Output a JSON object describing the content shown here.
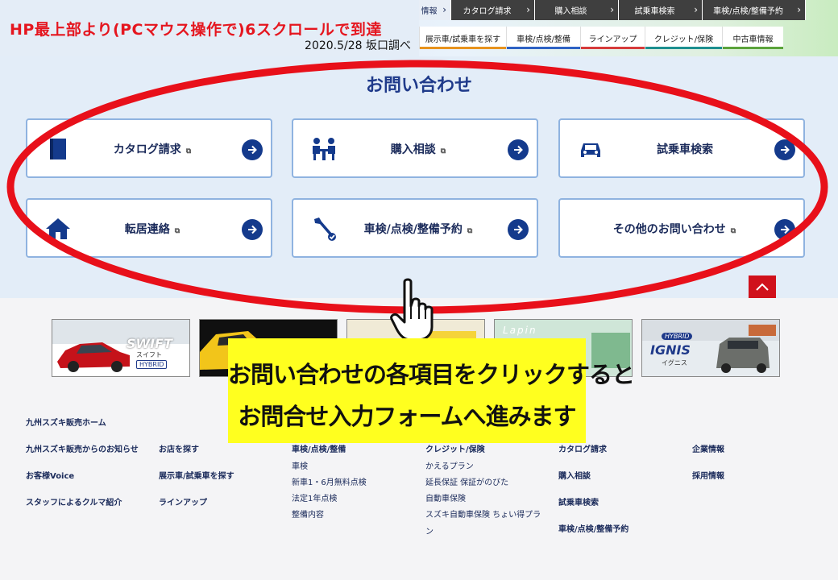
{
  "annotation": {
    "title": "HP最上部より(PCマウス操作で)6スクロールで到達",
    "date": "2020.5/28 坂口調べ",
    "callout_line1": "お問い合わせの各項目をクリックすると",
    "callout_line2": "お問合せ入力フォームへ進みます"
  },
  "nav_top": [
    {
      "label": "情報",
      "active": true
    },
    {
      "label": "カタログ請求",
      "active": false
    },
    {
      "label": "購入相談",
      "active": false
    },
    {
      "label": "試乗車検索",
      "active": false
    },
    {
      "label": "車検/点検/整備予約",
      "active": false
    }
  ],
  "nav_sub": [
    {
      "label": "展示車/試乗車を探す",
      "color": "#e8931e"
    },
    {
      "label": "車検/点検/整備",
      "color": "#2e62c4"
    },
    {
      "label": "ラインアップ",
      "color": "#d63b3b"
    },
    {
      "label": "クレジット/保険",
      "color": "#1d8f8f"
    },
    {
      "label": "中古車情報",
      "color": "#5ba33b"
    }
  ],
  "contact": {
    "title": "お問い合わせ",
    "buttons": [
      {
        "label": "カタログ請求",
        "icon": "book-icon"
      },
      {
        "label": "購入相談",
        "icon": "consultation-icon"
      },
      {
        "label": "試乗車検索",
        "icon": "car-icon"
      },
      {
        "label": "転居連絡",
        "icon": "house-icon"
      },
      {
        "label": "車検/点検/整備予約",
        "icon": "wrench-icon"
      },
      {
        "label": "その他のお問い合わせ",
        "icon": ""
      }
    ]
  },
  "banners": {
    "swift_logo": "SWIFT",
    "swift_sub": "スイフト",
    "swift_badge": "HYBRID",
    "lapin_logo": "Lapin",
    "ignis_badge": "HYBRID",
    "ignis_logo": "IGNIS",
    "ignis_sub": "イグニス"
  },
  "footer": {
    "home": "九州スズキ販売ホーム",
    "col1": [
      "九州スズキ販売からのお知らせ",
      "お客様Voice",
      "スタッフによるクルマ紹介"
    ],
    "col2": [
      "お店を探す",
      "展示車/試乗車を探す",
      "ラインアップ"
    ],
    "col3_head": "車検/点検/整備",
    "col3": [
      "車検",
      "新車1・6月無料点検",
      "法定1年点検",
      "整備内容"
    ],
    "col4_head": "クレジット/保険",
    "col4": [
      "かえるプラン",
      "延長保証 保証がのびた",
      "自動車保険",
      "スズキ自動車保険 ちょい得プラ",
      "ン"
    ],
    "col5": [
      "カタログ請求",
      "購入相談",
      "試乗車検索",
      "車検/点検/整備予約"
    ],
    "col6": [
      "企業情報",
      "採用情報"
    ]
  },
  "colors": {
    "accent_red": "#e5161f",
    "brand_navy": "#143a8c",
    "callout_yellow": "#ffff1f"
  }
}
